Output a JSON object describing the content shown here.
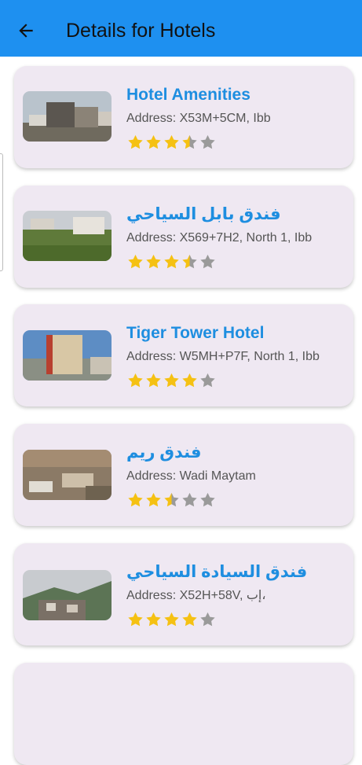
{
  "app_bar": {
    "title": "Details for Hotels",
    "back_icon": "arrow-back-icon",
    "color": "#1e90f0"
  },
  "hotels": [
    {
      "name": "Hotel Amenities",
      "address": "Address: X53M+5CM, Ibb",
      "rating": 3.5
    },
    {
      "name": "فندق بابل السياحي",
      "address": "Address: X569+7H2, North 1, Ibb",
      "rating": 3.5
    },
    {
      "name": "Tiger Tower Hotel",
      "address": "Address: W5MH+P7F, North 1, Ibb",
      "rating": 4
    },
    {
      "name": "فندق ريم",
      "address": "Address: Wadi Maytam",
      "rating": 2.5
    },
    {
      "name": "فندق السيادة السياحي",
      "address": "Address: X52H+58V, إب،",
      "rating": 4
    }
  ],
  "colors": {
    "star_filled": "#f5c113",
    "star_empty": "#9a9a9a",
    "title_text": "#1e8ee0",
    "card_bg": "#efe8f2"
  }
}
